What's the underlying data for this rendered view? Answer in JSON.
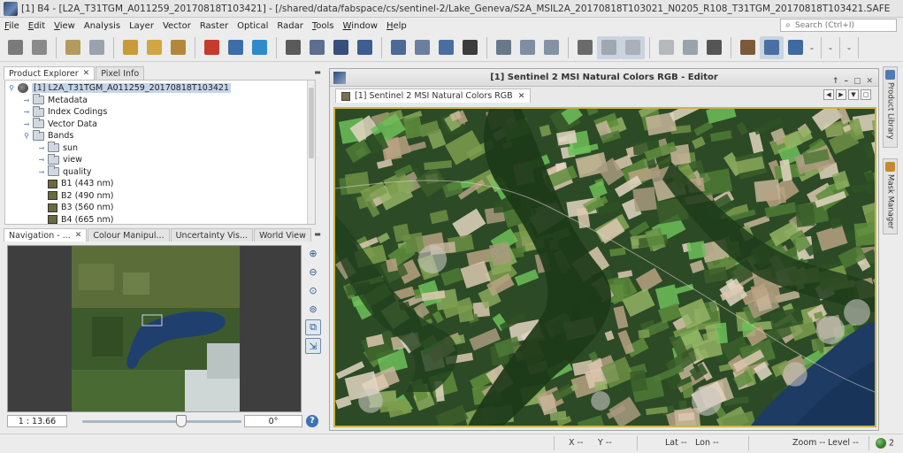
{
  "window": {
    "title": "[1] B4 - [L2A_T31TGM_A011259_20170818T103421] - [/shared/data/fabspace/cs/sentinel-2/Lake_Geneva/S2A_MSIL2A_20170818T103021_N0205_R108_T31TGM_20170818T103421.SAFE"
  },
  "menu": {
    "items": [
      {
        "label": "File",
        "u": "F",
        "rest": "ile"
      },
      {
        "label": "Edit",
        "u": "E",
        "rest": "dit"
      },
      {
        "label": "View",
        "u": "V",
        "rest": "iew"
      },
      {
        "label": "Analysis",
        "u": "",
        "rest": "Analysis"
      },
      {
        "label": "Layer",
        "u": "",
        "rest": "Layer"
      },
      {
        "label": "Vector",
        "u": "",
        "rest": "Vector"
      },
      {
        "label": "Raster",
        "u": "",
        "rest": "Raster"
      },
      {
        "label": "Optical",
        "u": "",
        "rest": "Optical"
      },
      {
        "label": "Radar",
        "u": "",
        "rest": "Radar"
      },
      {
        "label": "Tools",
        "u": "T",
        "rest": "ools"
      },
      {
        "label": "Window",
        "u": "W",
        "rest": "indow"
      },
      {
        "label": "Help",
        "u": "H",
        "rest": "elp"
      }
    ],
    "search_placeholder": "Search (Ctrl+I)"
  },
  "toolbar": {
    "icons": [
      "open-product-icon",
      "save-product-icon",
      "undo-icon",
      "redo-icon",
      "import-icon",
      "export-icon",
      "session-icon",
      "color-manip-icon",
      "band-maths-icon",
      "graph-builder-icon",
      "spectrum-icon",
      "profile-plot-icon",
      "statistics-icon",
      "histogram-icon",
      "information-icon",
      "scatter-plot-icon",
      "scatter-density-icon",
      "sum-icon",
      "range-finder-icon",
      "pin-manager-icon",
      "gcp-manager-icon",
      "grid-icon",
      "overlay-icon",
      "mask-icon",
      "graticule-icon",
      "pixel-info-icon",
      "select-tool-icon",
      "pan-tool-icon",
      "zoom-tool-icon",
      "pin-tool-icon"
    ]
  },
  "product_explorer": {
    "tabs": [
      "Product Explorer",
      "Pixel Info"
    ],
    "tree": [
      {
        "label": "[1] L2A_T31TGM_A011259_20170818T103421",
        "kind": "product",
        "level": 0,
        "toggle": "open",
        "selected": true
      },
      {
        "label": "Metadata",
        "kind": "folder",
        "level": 1,
        "toggle": "closed"
      },
      {
        "label": "Index Codings",
        "kind": "folder",
        "level": 1,
        "toggle": "closed"
      },
      {
        "label": "Vector Data",
        "kind": "folder",
        "level": 1,
        "toggle": "closed"
      },
      {
        "label": "Bands",
        "kind": "folder",
        "level": 1,
        "toggle": "open"
      },
      {
        "label": "sun",
        "kind": "folder",
        "level": 2,
        "toggle": "closed"
      },
      {
        "label": "view",
        "kind": "folder",
        "level": 2,
        "toggle": "closed"
      },
      {
        "label": "quality",
        "kind": "folder",
        "level": 2,
        "toggle": "closed"
      },
      {
        "label": "B1 (443 nm)",
        "kind": "band",
        "level": 2,
        "toggle": ""
      },
      {
        "label": "B2 (490 nm)",
        "kind": "band",
        "level": 2,
        "toggle": ""
      },
      {
        "label": "B3 (560 nm)",
        "kind": "band",
        "level": 2,
        "toggle": ""
      },
      {
        "label": "B4 (665 nm)",
        "kind": "band",
        "level": 2,
        "toggle": ""
      }
    ]
  },
  "navigation": {
    "tabs": [
      "Navigation - ...",
      "Colour Manipul...",
      "Uncertainty Vis...",
      "World View"
    ],
    "zoom_factor": "1 : 13.66",
    "rotation": "0°",
    "slider_fraction": 0.62
  },
  "editor": {
    "title": "[1] Sentinel 2 MSI Natural Colors RGB - Editor",
    "tab_label": "[1] Sentinel 2 MSI Natural Colors RGB"
  },
  "right_rail": {
    "tabs": [
      "Product Library",
      "Mask Manager"
    ]
  },
  "status": {
    "x_label": "X",
    "x_val": "--",
    "y_label": "Y",
    "y_val": "--",
    "lat_label": "Lat",
    "lat_val": "--",
    "lon_label": "Lon",
    "lon_val": "--",
    "zoom_label": "Zoom",
    "zoom_val": "--",
    "level_label": "Level",
    "level_val": "--",
    "globe_count": "2"
  }
}
